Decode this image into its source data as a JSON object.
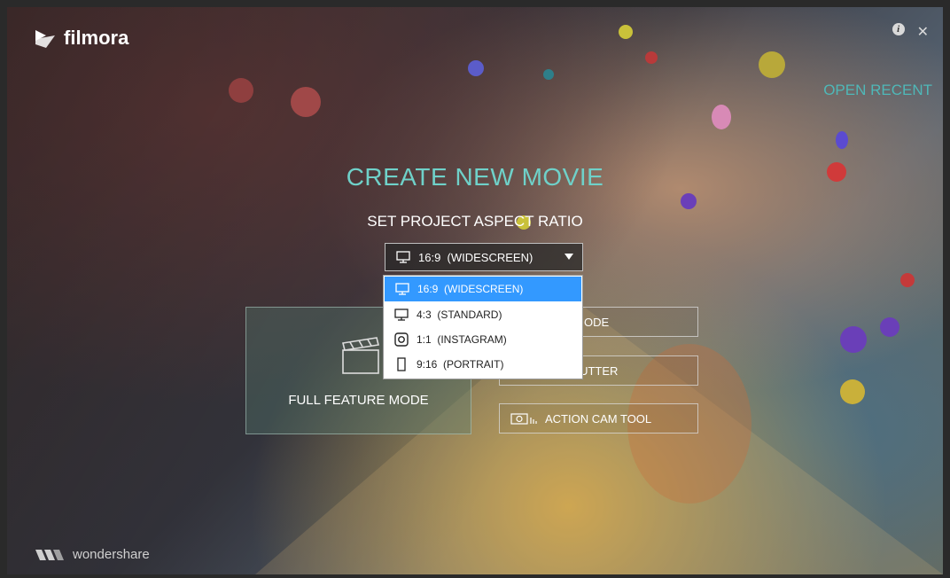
{
  "app": {
    "logo_text": "filmora",
    "vendor": "wondershare"
  },
  "header": {
    "open_recent": "OPEN RECENT",
    "info_icon": "i",
    "close_icon": "✕"
  },
  "main": {
    "title": "CREATE NEW MOVIE",
    "subtitle": "SET PROJECT ASPECT RATIO",
    "aspect_select": {
      "selected": "16:9  (WIDESCREEN)",
      "options": [
        {
          "label": "16:9  (WIDESCREEN)",
          "icon": "monitor-icon"
        },
        {
          "label": "4:3  (STANDARD)",
          "icon": "monitor-icon"
        },
        {
          "label": "1:1  (INSTAGRAM)",
          "icon": "instagram-icon"
        },
        {
          "label": "9:16  (PORTRAIT)",
          "icon": "phone-portrait-icon"
        }
      ]
    },
    "modes": {
      "full_feature": "FULL FEATURE MODE",
      "easy_mode_visible": "ODE",
      "instant_cutter_visible": "NT CUTTER",
      "action_cam": "ACTION CAM TOOL"
    }
  },
  "colors": {
    "accent": "#6fd1c9",
    "selection": "#3399ff"
  }
}
